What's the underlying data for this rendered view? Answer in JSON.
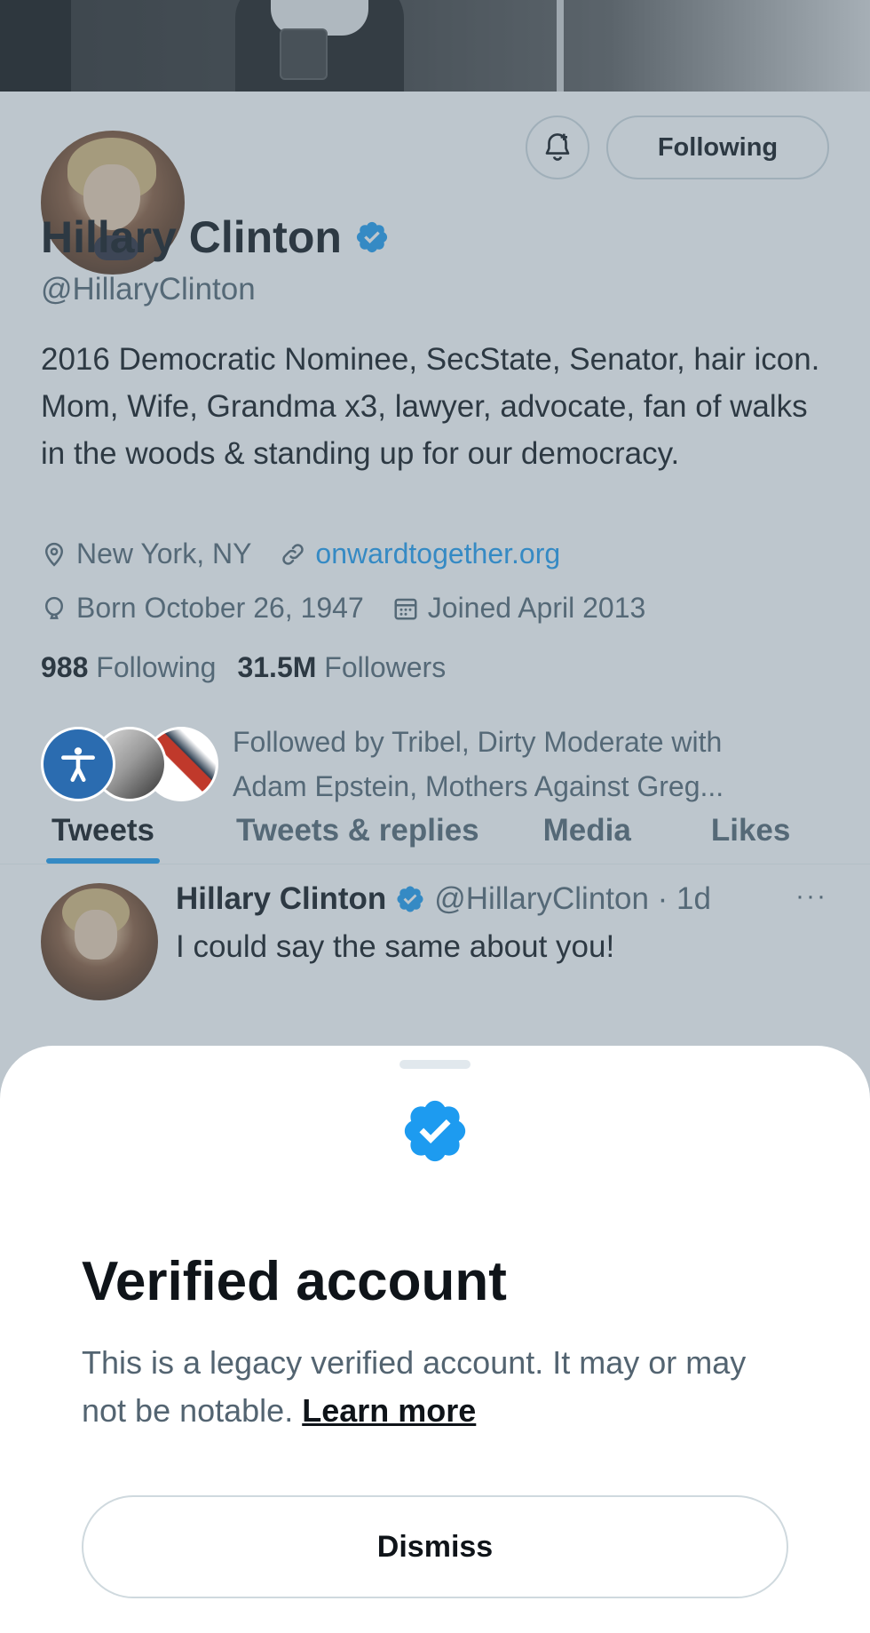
{
  "colors": {
    "accent": "#1d9bf0",
    "verified_badge": "#1d9bf0",
    "text_primary": "#0f1419",
    "text_secondary": "#536471",
    "overlay": "rgba(91,112,131,0.4)"
  },
  "profile": {
    "name": "Hillary Clinton",
    "handle": "@HillaryClinton",
    "bio": "2016 Democratic Nominee, SecState, Senator, hair icon. Mom, Wife, Grandma x3, lawyer, advocate, fan of walks in the woods & standing up for our democracy.",
    "location": "New York, NY",
    "website": "onwardtogether.org",
    "born": "Born October 26, 1947",
    "joined": "Joined April 2013",
    "following_count": "988",
    "following_label": "Following",
    "followers_count": "31.5M",
    "followers_label": "Followers",
    "followed_by": "Followed by Tribel, Dirty Moderate with Adam Epstein, Mothers Against Greg...",
    "follow_button_label": "Following",
    "icons": {
      "notify": "bell-plus-icon",
      "verified": "verified-badge-icon",
      "location": "location-pin-icon",
      "link": "link-icon",
      "birthday": "balloon-icon",
      "joined": "calendar-icon"
    }
  },
  "tabs": [
    {
      "label": "Tweets",
      "active": true
    },
    {
      "label": "Tweets & replies",
      "active": false
    },
    {
      "label": "Media",
      "active": false
    },
    {
      "label": "Likes",
      "active": false
    }
  ],
  "tweet": {
    "name": "Hillary Clinton",
    "handle_time": "@HillaryClinton · 1d",
    "text": "I could say the same about you!",
    "more": "···"
  },
  "sheet": {
    "title": "Verified account",
    "description": "This is a legacy verified account. It may or may not be notable.",
    "learn_more": "Learn more",
    "dismiss_label": "Dismiss"
  }
}
